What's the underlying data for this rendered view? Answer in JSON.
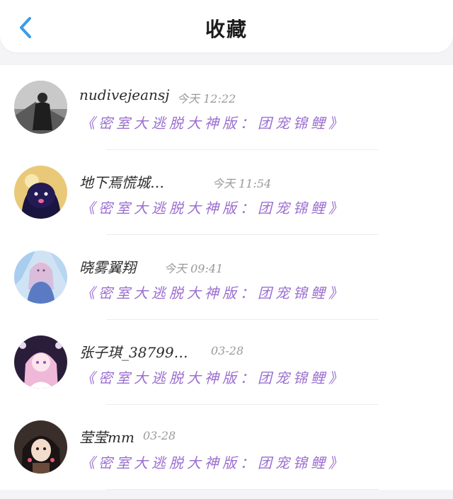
{
  "header": {
    "title": "收藏",
    "back_icon": "chevron-left-icon",
    "accent_color": "#3b9be8"
  },
  "items": [
    {
      "username": "nudivejeansj",
      "time": "今天 12:22",
      "link": "《密室大逃脱大神版：团宠锦鲤》",
      "avatar": "avatar-icon"
    },
    {
      "username": "地下焉慌城…",
      "time": "今天 11:54",
      "link": "《密室大逃脱大神版：团宠锦鲤》",
      "avatar": "avatar-icon"
    },
    {
      "username": "晓雾翼翔",
      "time": "今天 09:41",
      "link": "《密室大逃脱大神版：团宠锦鲤》",
      "avatar": "avatar-icon"
    },
    {
      "username": "张子琪_38799…",
      "time": "03-28",
      "link": "《密室大逃脱大神版：团宠锦鲤》",
      "avatar": "avatar-icon"
    },
    {
      "username": "莹莹mm",
      "time": "03-28",
      "link": "《密室大逃脱大神版：团宠锦鲤》",
      "avatar": "avatar-icon"
    }
  ],
  "colors": {
    "link": "#9b6fd0",
    "time": "#9a9a9a",
    "background": "#f4f4f6"
  }
}
